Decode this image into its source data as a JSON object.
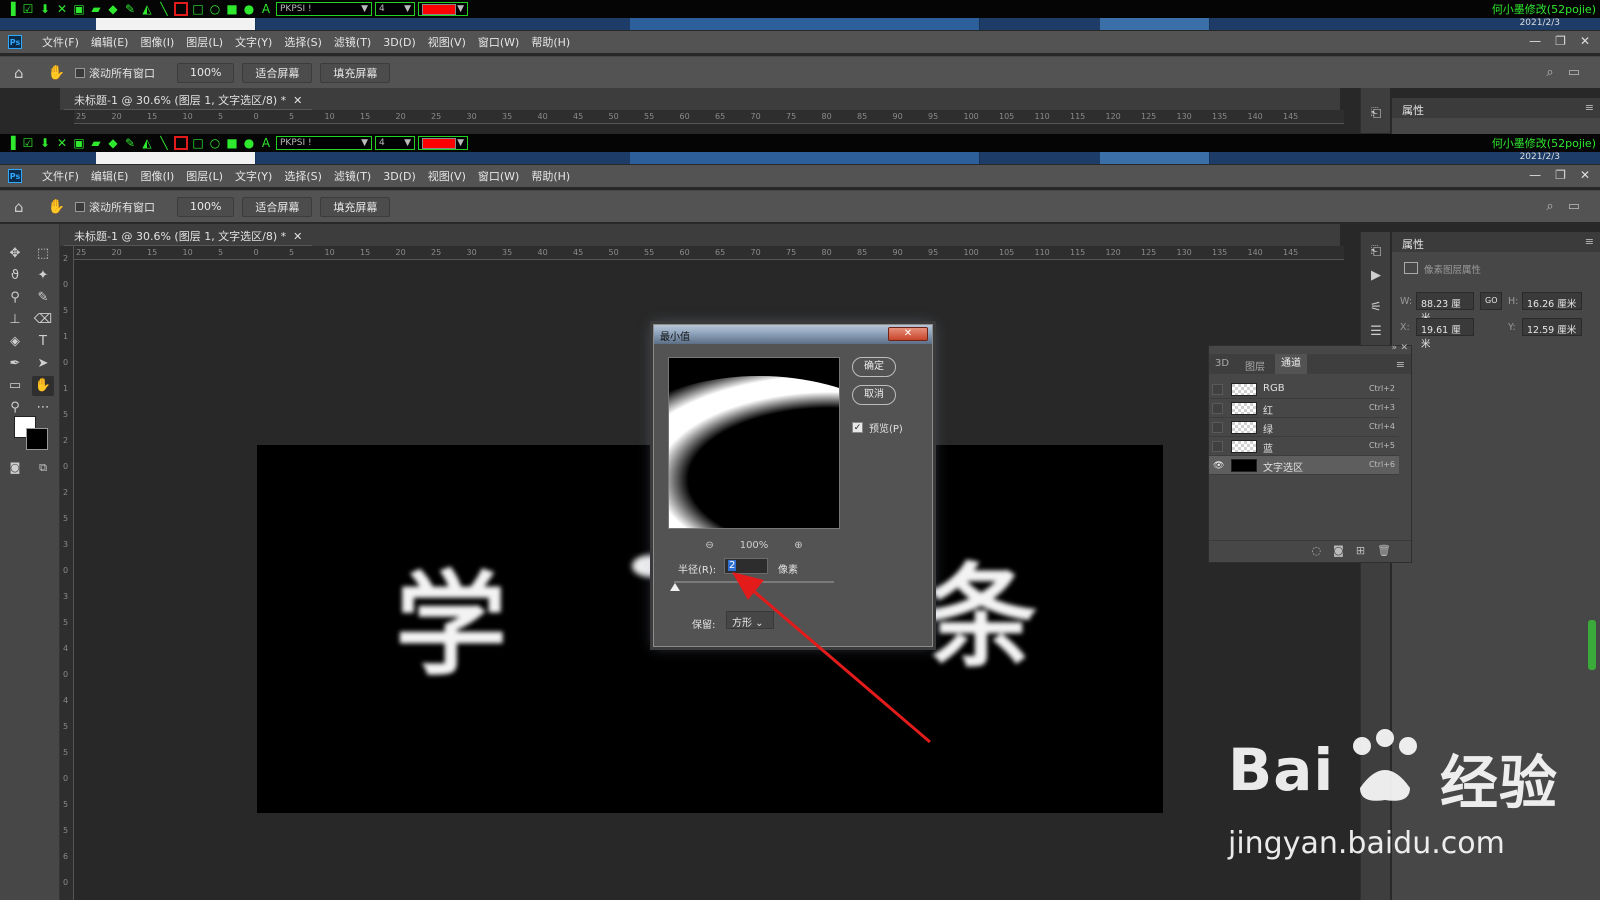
{
  "recorder": {
    "font_combo": "PKPSI !",
    "size_combo": "4",
    "signature": "何小墨修改(52pojie)",
    "date": "2021/2/3"
  },
  "menubar": {
    "items": [
      "文件(F)",
      "编辑(E)",
      "图像(I)",
      "图层(L)",
      "文字(Y)",
      "选择(S)",
      "滤镜(T)",
      "3D(D)",
      "视图(V)",
      "窗口(W)",
      "帮助(H)"
    ],
    "ps_logo": "Ps"
  },
  "options": {
    "scroll_all_label": "滚动所有窗口",
    "zoom_btn": "100%",
    "fit_btn": "适合屏幕",
    "fill_btn": "填充屏幕"
  },
  "document": {
    "tab_title": "未标题-1 @ 30.6% (图层 1, 文字选区/8) *",
    "canvas_chars": [
      "学",
      "条"
    ]
  },
  "ruler_ticks": [
    "25",
    "20",
    "15",
    "10",
    "5",
    "0",
    "5",
    "10",
    "15",
    "20",
    "25",
    "30",
    "35",
    "40",
    "45",
    "50",
    "55",
    "60",
    "65",
    "70",
    "75",
    "80",
    "85",
    "90",
    "95",
    "100",
    "105",
    "110",
    "115",
    "120",
    "125",
    "130",
    "135",
    "140",
    "145"
  ],
  "properties": {
    "title": "属性",
    "subtitle": "像素图层属性",
    "w_label": "W:",
    "w_value": "88.23 厘米",
    "h_label": "H:",
    "h_value": "16.26 厘米",
    "x_label": "X:",
    "x_value": "19.61 厘米",
    "y_label": "Y:",
    "y_value": "12.59 厘米",
    "link": "GO"
  },
  "channels": {
    "tabs": [
      "3D",
      "图层",
      "通道"
    ],
    "rows": [
      {
        "name": "RGB",
        "shortcut": "Ctrl+2"
      },
      {
        "name": "红",
        "shortcut": "Ctrl+3"
      },
      {
        "name": "绿",
        "shortcut": "Ctrl+4"
      },
      {
        "name": "蓝",
        "shortcut": "Ctrl+5"
      },
      {
        "name": "文字选区",
        "shortcut": "Ctrl+6"
      }
    ]
  },
  "dialog": {
    "title": "最小值",
    "ok": "确定",
    "cancel": "取消",
    "preview_label": "预览(P)",
    "zoom": "100%",
    "radius_label": "半径(R):",
    "radius_value": "2",
    "unit": "像素",
    "preserve_label": "保留:",
    "preserve_value": "方形"
  },
  "watermark": {
    "brand": "Bai",
    "brand2": "经验",
    "url": "jingyan.baidu.com"
  },
  "colors": {
    "annotation_arrow": "#e31b1b",
    "recorder_green": "#22e322"
  }
}
